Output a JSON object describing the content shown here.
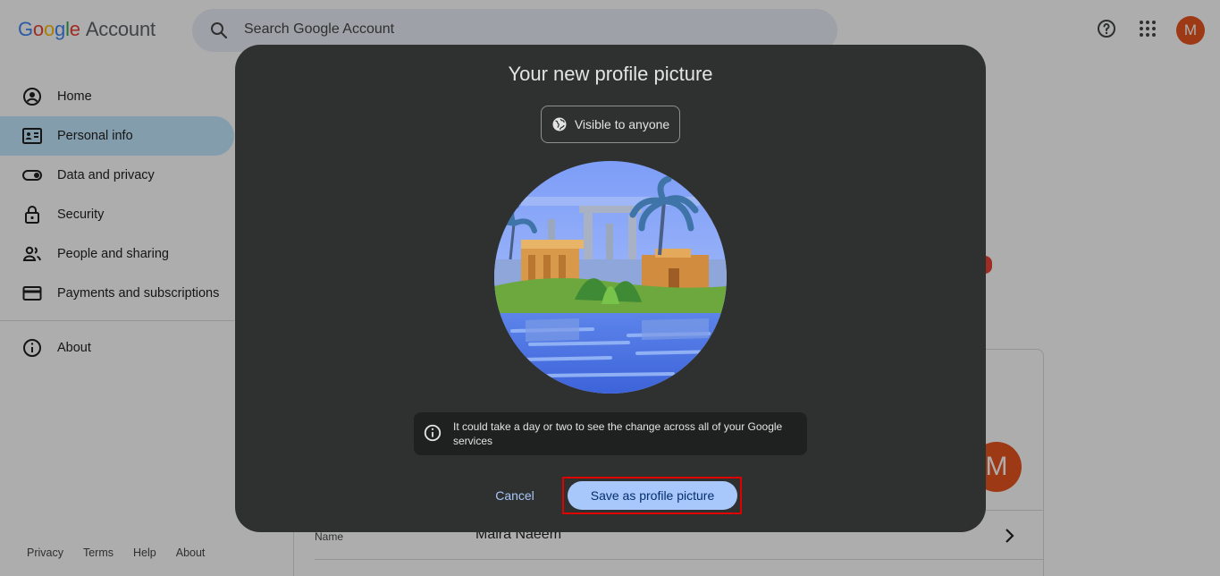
{
  "header": {
    "logo_google": [
      "G",
      "o",
      "o",
      "g",
      "l",
      "e"
    ],
    "logo_account": "Account",
    "search_placeholder": "Search Google Account",
    "avatar_letter": "M"
  },
  "sidebar": {
    "items": [
      {
        "label": "Home",
        "icon": "account-circle-icon"
      },
      {
        "label": "Personal info",
        "icon": "id-card-icon",
        "active": true
      },
      {
        "label": "Data and privacy",
        "icon": "toggle-icon"
      },
      {
        "label": "Security",
        "icon": "lock-icon"
      },
      {
        "label": "People and sharing",
        "icon": "people-icon"
      },
      {
        "label": "Payments and subscriptions",
        "icon": "credit-card-icon"
      }
    ],
    "about": "About"
  },
  "footer": {
    "privacy": "Privacy",
    "terms": "Terms",
    "help": "Help",
    "about": "About"
  },
  "main": {
    "avatar_letter": "M",
    "name_label": "Name",
    "name_value": "Maira Naeem"
  },
  "dialog": {
    "title": "Your new profile picture",
    "visibility": "Visible to anyone",
    "notice": "It could take a day or two to see the change across all of your Google services",
    "cancel": "Cancel",
    "save": "Save as profile picture"
  },
  "colors": {
    "dialog_bg": "#2f3131",
    "primary": "#a8c7fa",
    "avatar": "#e8541e",
    "highlight": "#e00000"
  }
}
